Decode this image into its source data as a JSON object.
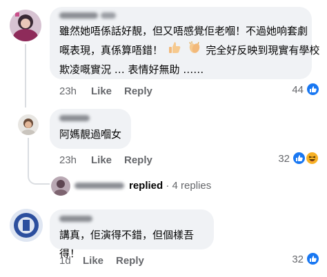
{
  "comments": [
    {
      "text_lines": [
        "雖然她唔係話好靚，但又唔感覺佢老嗰！不過她响套劇",
        "嘅表現，真係算唔錯！",
        "完全好反映到現實有學校",
        "欺凌嘅實況 … 表情好無助 ……"
      ],
      "time": "23h",
      "like_label": "Like",
      "reply_label": "Reply",
      "reaction_count": "44",
      "reactions": [
        "like-icon"
      ]
    },
    {
      "text_lines": [
        "阿媽靚過嗰女"
      ],
      "time": "23h",
      "like_label": "Like",
      "reply_label": "Reply",
      "reaction_count": "32",
      "reactions": [
        "like-icon",
        "haha-icon"
      ]
    },
    {
      "text_lines": [
        "講真，佢演得不錯，但個樣吾得！"
      ],
      "time": "1d",
      "like_label": "Like",
      "reply_label": "Reply",
      "reaction_count": "32",
      "reactions": [
        "like-icon"
      ]
    }
  ],
  "replies_summary": {
    "verb": "replied",
    "separator": "·",
    "count_text": "4 replies"
  },
  "colors": {
    "bubble": "#f0f2f5",
    "meta": "#65676b",
    "like": "#1877f2",
    "haha": "#f7b125"
  }
}
